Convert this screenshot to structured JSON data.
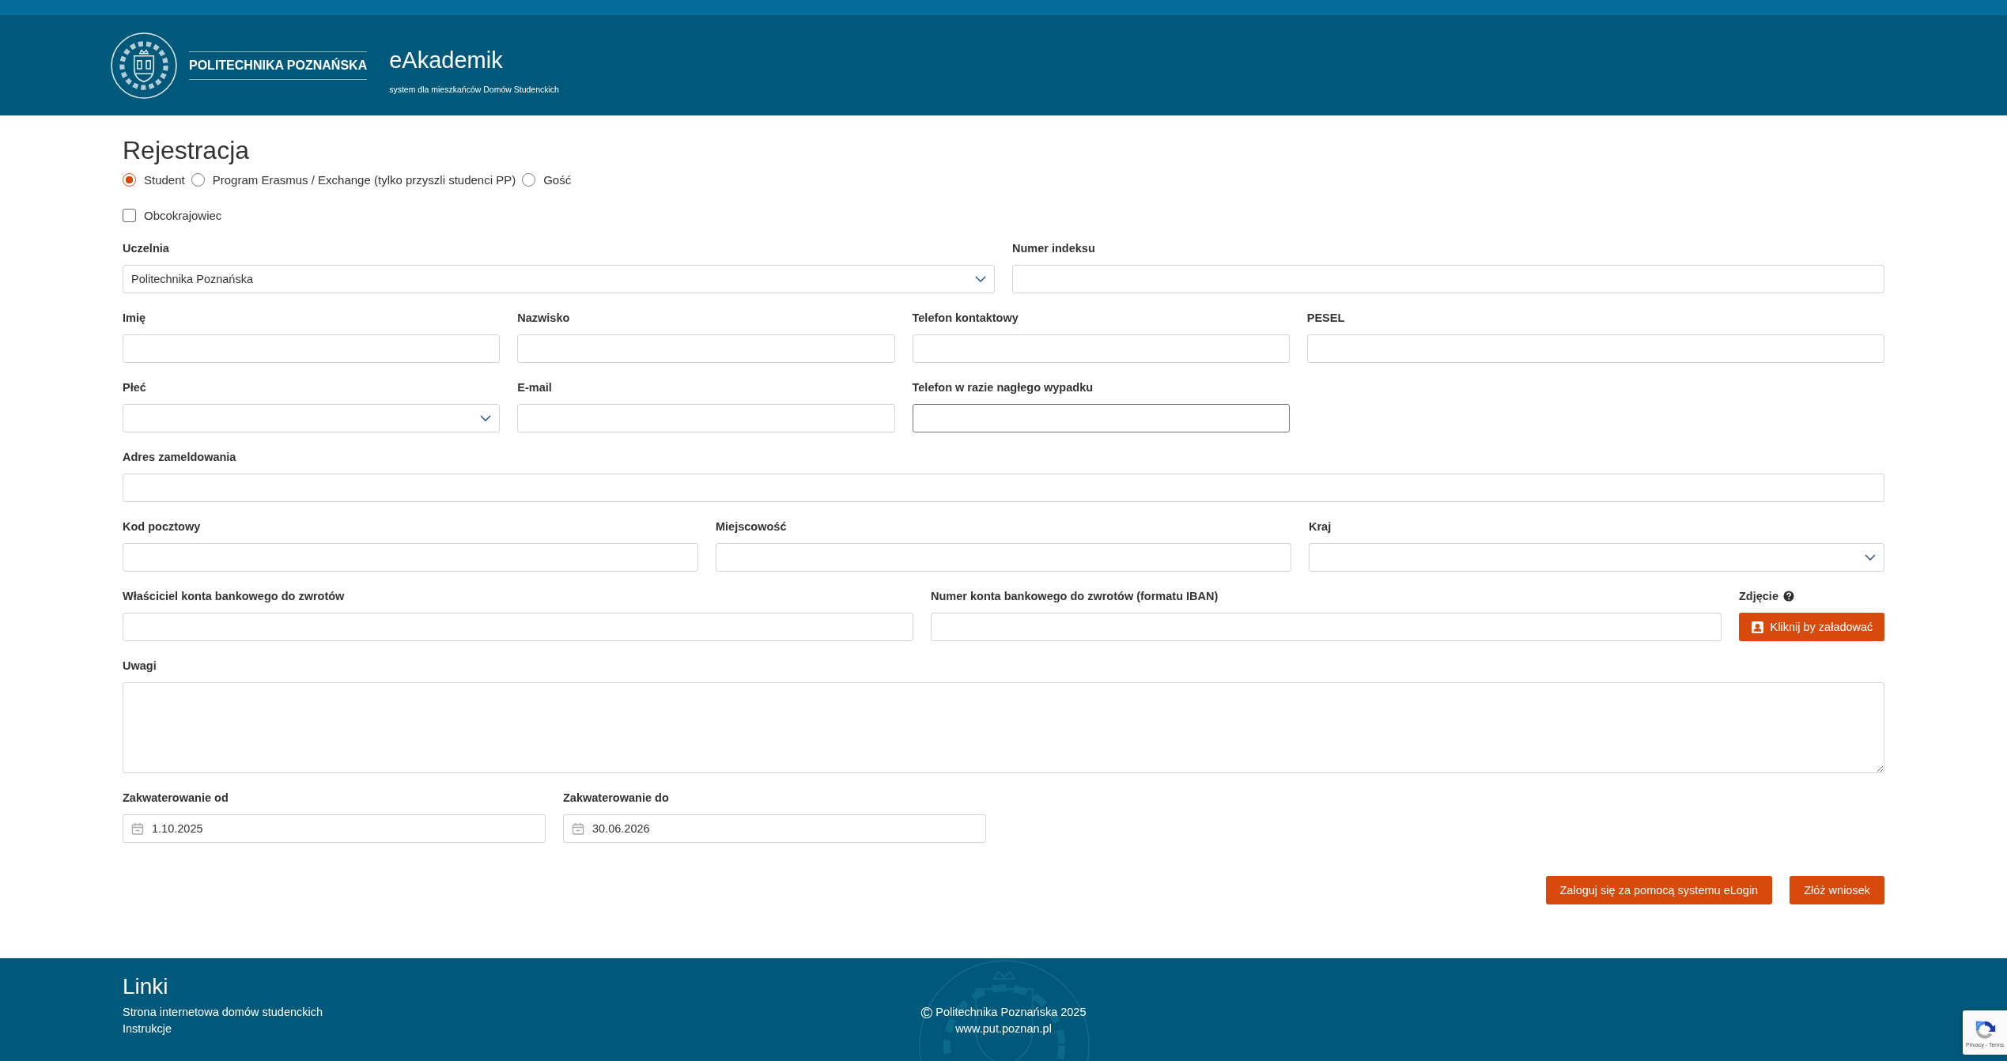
{
  "header": {
    "university": "POLITECHNIKA POZNAŃSKA",
    "app_title": "eAkademik",
    "app_subtitle": "system dla mieszkańców Domów Studenckich"
  },
  "form": {
    "title": "Rejestracja",
    "applicant_types": [
      {
        "label": "Student",
        "selected": true
      },
      {
        "label": "Program Erasmus / Exchange (tylko przyszli studenci PP)",
        "selected": false
      },
      {
        "label": "Gość",
        "selected": false
      }
    ],
    "foreigner": {
      "label": "Obcokrajowiec",
      "checked": false
    },
    "field_groups": [
      {
        "fields": [
          {
            "label": "Uczelnia",
            "kind": "select",
            "value": "Politechnika Poznańska"
          },
          {
            "label": "Numer indeksu",
            "kind": "text"
          }
        ]
      },
      {
        "fields": [
          {
            "label": "Imię",
            "kind": "text"
          },
          {
            "label": "Nazwisko",
            "kind": "text"
          },
          {
            "label": "Telefon kontaktowy",
            "kind": "text"
          },
          {
            "label": "PESEL",
            "kind": "text"
          }
        ]
      },
      {
        "fields": [
          {
            "label": "Płeć",
            "kind": "select"
          },
          {
            "label": "E-mail",
            "kind": "text"
          },
          {
            "label": "Telefon w razie nagłego wypadku",
            "kind": "text",
            "focused": true
          }
        ]
      },
      {
        "fields": [
          {
            "label": "Adres zameldowania",
            "kind": "text"
          }
        ]
      },
      {
        "fields": [
          {
            "label": "Kod pocztowy",
            "kind": "text"
          },
          {
            "label": "Miejscowość",
            "kind": "text"
          },
          {
            "label": "Kraj",
            "kind": "select"
          }
        ]
      },
      {
        "fields": [
          {
            "label": "Właściciel konta bankowego do zwrotów",
            "kind": "text"
          },
          {
            "label": "Numer konta bankowego do zwrotów (formatu IBAN)",
            "kind": "text"
          },
          {
            "label": "Zdjęcie",
            "kind": "upload",
            "help": true,
            "button": "Kliknij by załadować"
          }
        ]
      },
      {
        "fields": [
          {
            "label": "Uwagi",
            "kind": "textarea"
          }
        ]
      },
      {
        "fields": [
          {
            "label": "Zakwaterowanie od",
            "kind": "date",
            "value": "1.10.2025"
          },
          {
            "label": "Zakwaterowanie do",
            "kind": "date",
            "value": "30.06.2026"
          }
        ]
      }
    ],
    "buttons": [
      "Zaloguj się za pomocą systemu eLogin",
      "Złóż wniosek"
    ]
  },
  "footer": {
    "links_title": "Linki",
    "links": [
      "Strona internetowa domów studenckich",
      "Instrukcje"
    ],
    "copyright_symbol": "©",
    "copyright": "Politechnika Poznańska 2025",
    "website": "www.put.poznan.pl"
  },
  "recaptcha": {
    "text": "Privacy - Terms"
  }
}
